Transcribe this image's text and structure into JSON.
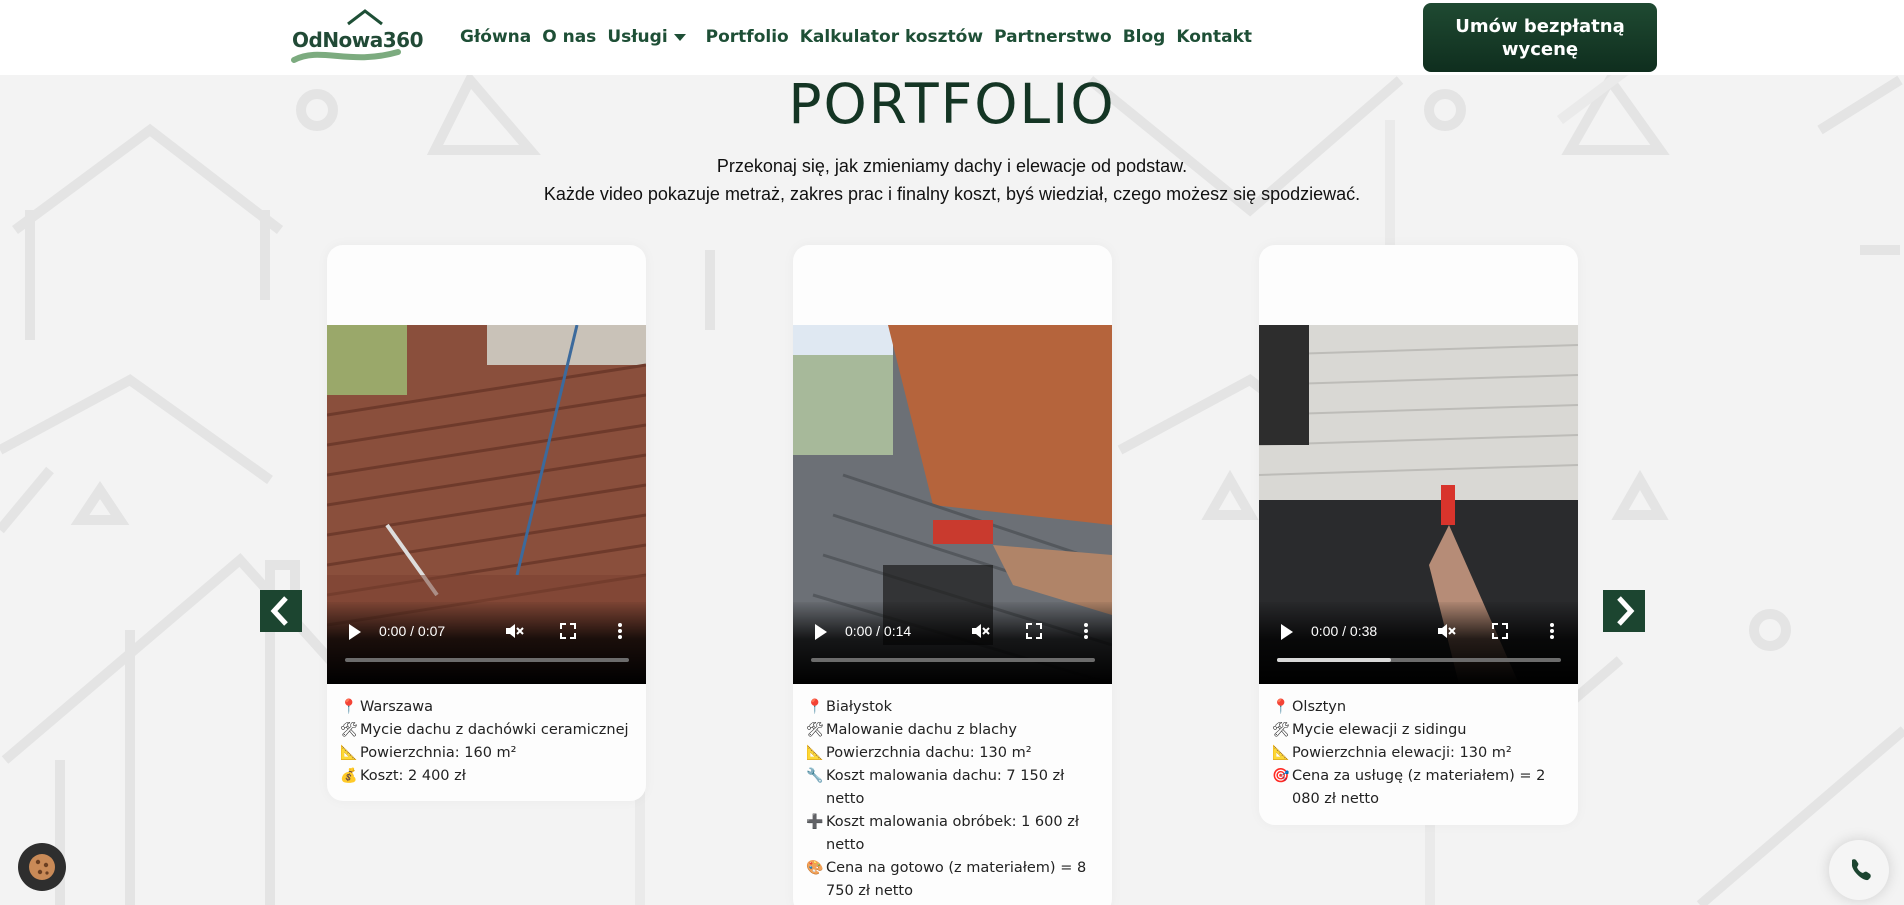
{
  "header": {
    "logo_text": "OdNowa360",
    "nav": [
      "Główna",
      "O nas",
      "Usługi",
      "Portfolio",
      "Kalkulator kosztów",
      "Partnerstwo",
      "Blog",
      "Kontakt"
    ],
    "cta_line1": "Umów bezpłatną",
    "cta_line2": "wycenę"
  },
  "main": {
    "title": "PORTFOLIO",
    "subtitle_line1": "Przekonaj się, jak zmieniamy dachy i elewacje od podstaw.",
    "subtitle_line2": "Każde video pokazuje metraż, zakres prac i finalny koszt, byś wiedział, czego możesz się spodziewać."
  },
  "cards": [
    {
      "video_time": "0:00 / 0:07",
      "progress": 0,
      "lines": [
        {
          "icon": "📍",
          "text": "Warszawa"
        },
        {
          "icon": "🛠",
          "text": "Mycie dachu z dachówki ceramicznej"
        },
        {
          "icon": "📐",
          "text": "Powierzchnia: 160 m²"
        },
        {
          "icon": "💰",
          "text": "Koszt: 2 400 zł"
        }
      ]
    },
    {
      "video_time": "0:00 / 0:14",
      "progress": 0,
      "lines": [
        {
          "icon": "📍",
          "text": "Białystok"
        },
        {
          "icon": "🛠",
          "text": "Malowanie dachu z blachy"
        },
        {
          "icon": "📐",
          "text": "Powierzchnia dachu: 130 m²"
        },
        {
          "icon": "🔧",
          "text": "Koszt malowania dachu: 7 150 zł netto"
        },
        {
          "icon": "➕",
          "text": "Koszt malowania obróbek: 1 600 zł netto"
        },
        {
          "icon": "🎨",
          "text": "Cena na gotowo (z materiałem) = 8 750 zł netto"
        }
      ]
    },
    {
      "video_time": "0:00 / 0:38",
      "progress": 0.4,
      "lines": [
        {
          "icon": "📍",
          "text": "Olsztyn"
        },
        {
          "icon": "🛠",
          "text": "Mycie elewacji z sidingu"
        },
        {
          "icon": "📐",
          "text": "Powierzchnia elewacji: 130 m²"
        },
        {
          "icon": "🎯",
          "text": "Cena za usługę (z materiałem) = 2 080 zł netto"
        }
      ]
    }
  ],
  "icons": {
    "prev": "chevron-left-icon",
    "next": "chevron-right-icon",
    "cookie": "cookie-icon",
    "phone": "phone-icon"
  },
  "colors": {
    "brand_dark": "#143524",
    "nav_green": "#1e4f36",
    "cta_bg": "#1f4a32",
    "page_bg": "#f3f3f3"
  }
}
